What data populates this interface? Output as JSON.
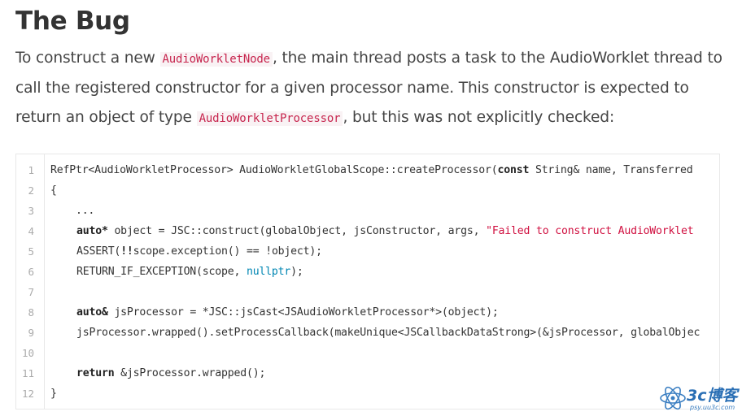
{
  "heading": "The Bug",
  "paragraph": {
    "p1": "To construct a new ",
    "code1": "AudioWorkletNode",
    "p2": ", the main thread posts a task to the AudioWorklet thread to call the registered constructor for a given processor name. This constructor is expected to return an object of type ",
    "code2": "AudioWorkletProcessor",
    "p3": ", but this was not explicitly checked:"
  },
  "code_block": {
    "line_numbers": [
      "1",
      "2",
      "3",
      "4",
      "5",
      "6",
      "7",
      "8",
      "9",
      "10",
      "11",
      "12"
    ],
    "lines": {
      "l1": "RefPtr<AudioWorkletProcessor> AudioWorkletGlobalScope::createProcessor(",
      "l1_kw": "const",
      "l1_b": " String& name, Transferred",
      "l2": "{",
      "l3": "    ...",
      "l4_kw": "auto*",
      "l4_a": " object = JSC::construct(globalObject, jsConstructor, args, ",
      "l4_str": "\"Failed to construct AudioWorklet",
      "l5_a": "ASSERT(",
      "l5_kw": "!!",
      "l5_b": "scope.exception() == !object);",
      "l6_a": "RETURN_IF_EXCEPTION(scope, ",
      "l6_nul": "nullptr",
      "l6_b": ");",
      "l8_kw": "auto&",
      "l8_a": " jsProcessor = *JSC::jsCast<JSAudioWorkletProcessor*>(object);",
      "l9": "jsProcessor.wrapped().setProcessCallback(makeUnique<JSCallbackDataStrong>(&jsProcessor, globalObjec",
      "l11_kw": "return",
      "l11_a": " &jsProcessor.wrapped();",
      "l12": "}"
    }
  },
  "watermark": {
    "text": "3c博客",
    "sub": "psy.uu3c.com"
  }
}
